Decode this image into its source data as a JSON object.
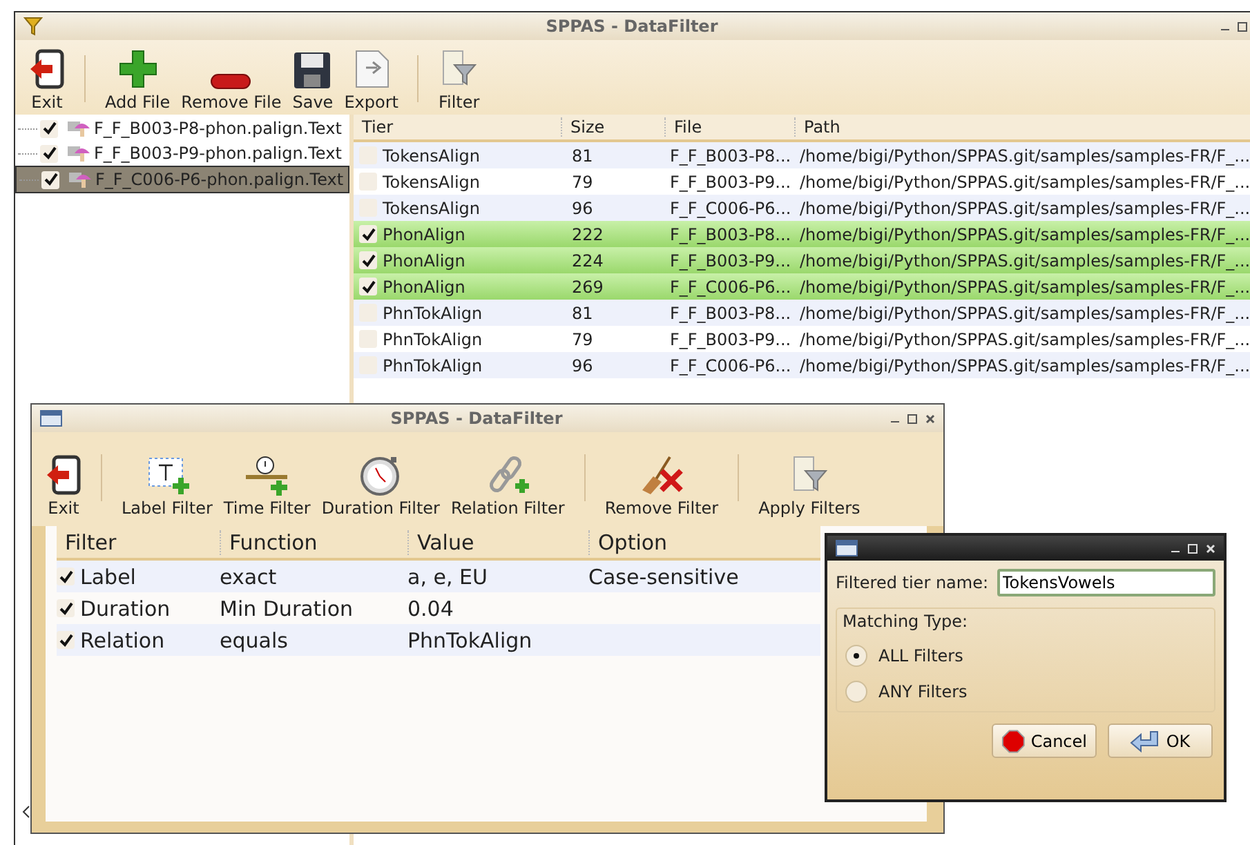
{
  "main_window": {
    "title": "SPPAS - DataFilter",
    "toolbar": [
      {
        "kind": "exit",
        "label": "Exit"
      },
      {
        "kind": "add",
        "label": "Add File"
      },
      {
        "kind": "remove",
        "label": "Remove File"
      },
      {
        "kind": "save",
        "label": "Save"
      },
      {
        "kind": "export",
        "label": "Export"
      },
      {
        "kind": "filter",
        "label": "Filter"
      }
    ],
    "files": [
      {
        "name": "F_F_B003-P8-phon.palign.Text",
        "checked": true,
        "selected": false
      },
      {
        "name": "F_F_B003-P9-phon.palign.Text",
        "checked": true,
        "selected": false
      },
      {
        "name": "F_F_C006-P6-phon.palign.Text",
        "checked": true,
        "selected": true
      }
    ],
    "table": {
      "columns": [
        "Tier",
        "Size",
        "File",
        "Path"
      ],
      "rows": [
        {
          "checked": false,
          "cells": [
            "TokensAlign",
            "81",
            "F_F_B003-P8...",
            "/home/bigi/Python/SPPAS.git/samples/samples-FR/F_..."
          ]
        },
        {
          "checked": false,
          "cells": [
            "TokensAlign",
            "79",
            "F_F_B003-P9...",
            "/home/bigi/Python/SPPAS.git/samples/samples-FR/F_..."
          ]
        },
        {
          "checked": false,
          "cells": [
            "TokensAlign",
            "96",
            "F_F_C006-P6...",
            "/home/bigi/Python/SPPAS.git/samples/samples-FR/F_..."
          ]
        },
        {
          "checked": true,
          "cells": [
            "PhonAlign",
            "222",
            "F_F_B003-P8...",
            "/home/bigi/Python/SPPAS.git/samples/samples-FR/F_..."
          ]
        },
        {
          "checked": true,
          "cells": [
            "PhonAlign",
            "224",
            "F_F_B003-P9...",
            "/home/bigi/Python/SPPAS.git/samples/samples-FR/F_..."
          ]
        },
        {
          "checked": true,
          "cells": [
            "PhonAlign",
            "269",
            "F_F_C006-P6...",
            "/home/bigi/Python/SPPAS.git/samples/samples-FR/F_..."
          ]
        },
        {
          "checked": false,
          "cells": [
            "PhnTokAlign",
            "81",
            "F_F_B003-P8...",
            "/home/bigi/Python/SPPAS.git/samples/samples-FR/F_..."
          ]
        },
        {
          "checked": false,
          "cells": [
            "PhnTokAlign",
            "79",
            "F_F_B003-P9...",
            "/home/bigi/Python/SPPAS.git/samples/samples-FR/F_..."
          ]
        },
        {
          "checked": false,
          "cells": [
            "PhnTokAlign",
            "96",
            "F_F_C006-P6...",
            "/home/bigi/Python/SPPAS.git/samples/samples-FR/F_..."
          ]
        }
      ]
    }
  },
  "filter_window": {
    "title": "SPPAS - DataFilter",
    "toolbar": [
      {
        "kind": "exit",
        "label": "Exit"
      },
      {
        "kind": "label",
        "label": "Label Filter"
      },
      {
        "kind": "time",
        "label": "Time Filter"
      },
      {
        "kind": "duration",
        "label": "Duration Filter"
      },
      {
        "kind": "relation",
        "label": "Relation Filter"
      },
      {
        "kind": "removefilter",
        "label": "Remove Filter"
      },
      {
        "kind": "apply",
        "label": "Apply Filters"
      }
    ],
    "table": {
      "columns": [
        "Filter",
        "Function",
        "Value",
        "Option"
      ],
      "rows": [
        {
          "checked": true,
          "cells": [
            "Label",
            "exact",
            "a, e, EU",
            "Case-sensitive"
          ]
        },
        {
          "checked": true,
          "cells": [
            "Duration",
            "Min Duration",
            "0.04",
            ""
          ]
        },
        {
          "checked": true,
          "cells": [
            "Relation",
            "equals",
            "PhnTokAlign",
            ""
          ]
        }
      ]
    }
  },
  "dialog": {
    "field_label": "Filtered tier name:",
    "field_value": "TokensVowels",
    "group_label": "Matching Type:",
    "options": [
      {
        "label": "ALL Filters",
        "selected": true
      },
      {
        "label": "ANY Filters",
        "selected": false
      }
    ],
    "buttons": [
      {
        "kind": "cancel",
        "label": "Cancel"
      },
      {
        "kind": "ok",
        "label": "OK"
      }
    ]
  }
}
